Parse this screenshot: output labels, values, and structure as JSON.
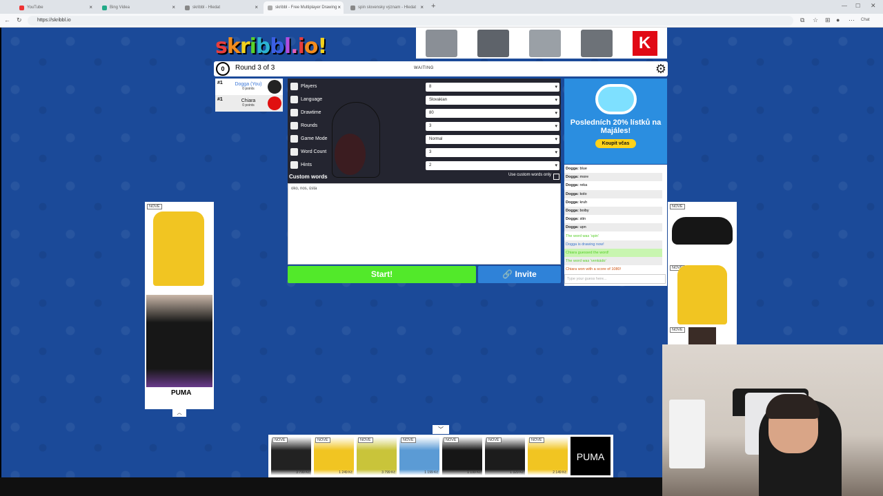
{
  "browser": {
    "tabs": [
      {
        "label": "YouTube",
        "color": "#e33"
      },
      {
        "label": "Bing Videa",
        "color": "#2a8"
      },
      {
        "label": "skribbl - Hledat",
        "color": "#888"
      },
      {
        "label": "skribbl - Free Multiplayer Drawing",
        "color": "#aaa"
      },
      {
        "label": "spin slovensky význam - Hledat",
        "color": "#888"
      }
    ],
    "url": "https://skribbl.io",
    "chat_button": "Chat"
  },
  "logo": "skribbl.io",
  "top_ad": {
    "brand": "K"
  },
  "game": {
    "clock": "0",
    "round": "Round 3 of 3",
    "status": "WAITING"
  },
  "players": [
    {
      "rank": "#1",
      "name": "Dogga (You)",
      "points": "0 points",
      "color": "#3b77d8",
      "avatar": "#222"
    },
    {
      "rank": "#1",
      "name": "Chiara",
      "points": "0 points",
      "color": "#111",
      "avatar": "#e01010"
    }
  ],
  "settings": [
    {
      "label": "Players",
      "value": "8"
    },
    {
      "label": "Language",
      "value": "Slovakian"
    },
    {
      "label": "Drawtime",
      "value": "80"
    },
    {
      "label": "Rounds",
      "value": "3"
    },
    {
      "label": "Game Mode",
      "value": "Normal"
    },
    {
      "label": "Word Count",
      "value": "3"
    },
    {
      "label": "Hints",
      "value": "2"
    }
  ],
  "custom_words": {
    "label": "Custom words",
    "only_label": "Use custom words only",
    "value": "oko, nos, ústa"
  },
  "buttons": {
    "start": "Start!",
    "invite": "Invite"
  },
  "right_ad": {
    "title": "Posledních 20% lístků na Majáles!",
    "button": "Koupit včas"
  },
  "chat": {
    "messages": [
      {
        "name": "Dogga",
        "text": "blue",
        "type": "user"
      },
      {
        "name": "Dogga",
        "text": "more",
        "type": "user"
      },
      {
        "name": "Dogga",
        "text": "reka",
        "type": "user"
      },
      {
        "name": "Dogga",
        "text": "kolo",
        "type": "user"
      },
      {
        "name": "Dogga",
        "text": "kruh",
        "type": "user"
      },
      {
        "name": "Dogga",
        "text": "boiby",
        "type": "user"
      },
      {
        "name": "Dogga",
        "text": "stin",
        "type": "user"
      },
      {
        "name": "Dogga",
        "text": "upn",
        "type": "user"
      },
      {
        "name": "",
        "text": "The word was 'spin'",
        "type": "green"
      },
      {
        "name": "",
        "text": "Dogga is drawing now!",
        "type": "blue"
      },
      {
        "name": "",
        "text": "Chiara guessed the word!",
        "type": "green"
      },
      {
        "name": "",
        "text": "The word was 'venkádo'",
        "type": "green"
      },
      {
        "name": "",
        "text": "Chiara won with a score of 1080!",
        "type": "orange"
      }
    ],
    "placeholder": "Type your guess here..."
  },
  "side_ads": {
    "badge": "NOVÉ",
    "brand": "PUMA"
  },
  "bottom_ad": {
    "items": [
      {
        "price": "3 799 Kč",
        "color": "#222"
      },
      {
        "price": "1 249 Kč",
        "color": "#f1c522"
      },
      {
        "price": "3 799 Kč",
        "color": "#c9c43a"
      },
      {
        "price": "1 199 Kč",
        "color": "#5b9bd5"
      },
      {
        "price": "1 199 Kč",
        "color": "#161616"
      },
      {
        "price": "1 329 Kč",
        "color": "#1c1c1c"
      },
      {
        "price": "2 149 Kč",
        "color": "#f1c522"
      }
    ]
  }
}
